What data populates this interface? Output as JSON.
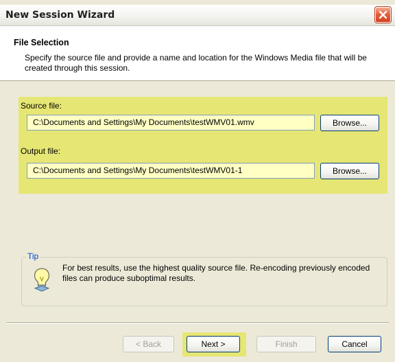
{
  "window": {
    "title": "New Session Wizard"
  },
  "header": {
    "title": "File Selection",
    "description": "Specify the source file and provide a name and location for the Windows Media file that will be created through this session."
  },
  "source": {
    "label": "Source file:",
    "value": "C:\\Documents and Settings\\My Documents\\testWMV01.wmv",
    "browse_label": "Browse..."
  },
  "output": {
    "label": "Output file:",
    "value": "C:\\Documents and Settings\\My Documents\\testWMV01-1",
    "browse_label": "Browse..."
  },
  "tip": {
    "legend": "Tip",
    "text": "For best results, use the highest quality source file. Re-encoding previously encoded files can produce suboptimal results.",
    "icon": "lightbulb-icon"
  },
  "footer": {
    "back_label": "< Back",
    "next_label": "Next >",
    "finish_label": "Finish",
    "cancel_label": "Cancel"
  },
  "colors": {
    "highlight": "#e6e674",
    "input_background": "#ffffc4",
    "dialog_background": "#ece9d8",
    "close_button": "#e5613f",
    "tip_legend": "#0046d5"
  }
}
